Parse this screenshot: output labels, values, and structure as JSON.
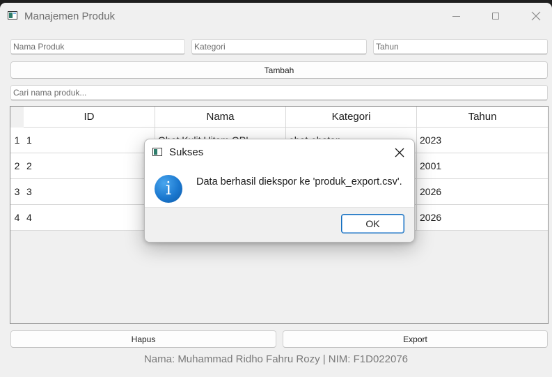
{
  "window": {
    "title": "Manajemen Produk"
  },
  "form": {
    "nama_placeholder": "Nama Produk",
    "kategori_placeholder": "Kategori",
    "tahun_placeholder": "Tahun",
    "add_label": "Tambah",
    "search_placeholder": "Cari nama produk..."
  },
  "table": {
    "headers": [
      "ID",
      "Nama",
      "Kategori",
      "Tahun"
    ],
    "row_numbers": [
      "1",
      "2",
      "3",
      "4"
    ],
    "rows": [
      [
        "1",
        "Obat Kulit Hitam OPI",
        "obat-obatan",
        "2023"
      ],
      [
        "2",
        "",
        "",
        "2001"
      ],
      [
        "3",
        "",
        "",
        "2026"
      ],
      [
        "4",
        "",
        "",
        "2026"
      ]
    ]
  },
  "actions": {
    "delete_label": "Hapus",
    "export_label": "Export"
  },
  "footer": {
    "text": "Nama: Muhammad Ridho Fahru Rozy | NIM: F1D022076"
  },
  "dialog": {
    "title": "Sukses",
    "icon": "info-icon",
    "icon_glyph": "i",
    "message": "Data berhasil diekspor ke 'produk_export.csv'.",
    "ok_label": "OK",
    "accent": "#0f6cbd"
  }
}
